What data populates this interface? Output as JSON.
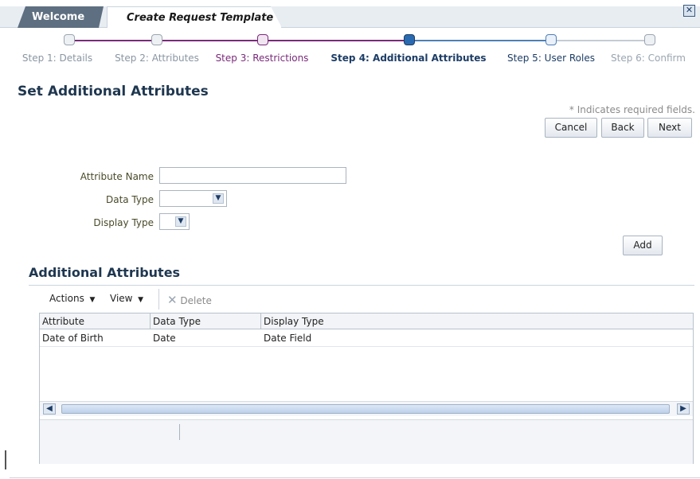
{
  "tabs": {
    "welcome": "Welcome",
    "active": "Create Request Template"
  },
  "train": {
    "steps": [
      {
        "label": "Step 1: Details",
        "state": "visited"
      },
      {
        "label": "Step 2: Attributes",
        "state": "visited"
      },
      {
        "label": "Step 3: Restrictions",
        "state": "visited"
      },
      {
        "label": "Step 4: Additional Attributes",
        "state": "current"
      },
      {
        "label": "Step 5: User Roles",
        "state": "next"
      },
      {
        "label": "Step 6: Confirm",
        "state": "unvisited"
      }
    ]
  },
  "page": {
    "title": "Set Additional Attributes",
    "required_note": "* Indicates required fields.",
    "buttons": {
      "cancel": "Cancel",
      "back": "Back",
      "next": "Next",
      "add": "Add"
    }
  },
  "form": {
    "attribute_name": {
      "label": "Attribute Name",
      "value": ""
    },
    "data_type": {
      "label": "Data Type",
      "value": ""
    },
    "display_type": {
      "label": "Display Type",
      "value": ""
    }
  },
  "section": {
    "title": "Additional Attributes",
    "toolbar": {
      "actions": "Actions",
      "view": "View",
      "delete": "Delete"
    },
    "columns": [
      "Attribute",
      "Data Type",
      "Display Type"
    ],
    "rows": [
      {
        "attribute": "Date of Birth",
        "data_type": "Date",
        "display_type": "Date Field"
      }
    ]
  },
  "colors": {
    "visited": "#7a2a7a",
    "current": "#1d3d66",
    "unvisited": "#9aa5b0",
    "heading": "#1f3750"
  }
}
